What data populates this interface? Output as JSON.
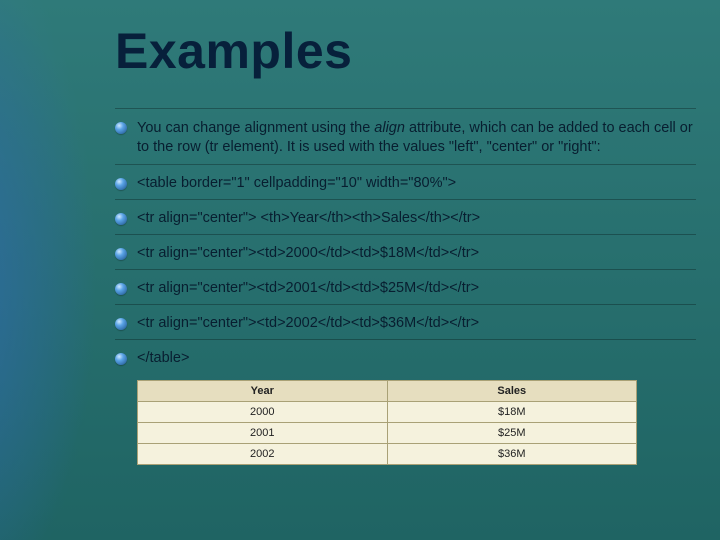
{
  "title": "Examples",
  "intro_before_italic": "You can change alignment using the ",
  "intro_italic": "align",
  "intro_after_italic": " attribute, which can be added to each cell or to the row (tr element). It is used with the values \"left\", \"center\" or \"right\":",
  "code_lines": [
    "<table border=\"1\" cellpadding=\"10\" width=\"80%\">",
    "<tr align=\"center\"> <th>Year</th><th>Sales</th></tr>",
    "<tr align=\"center\"><td>2000</td><td>$18M</td></tr>",
    "<tr align=\"center\"><td>2001</td><td>$25M</td></tr>",
    "<tr align=\"center\"><td>2002</td><td>$36M</td></tr>",
    "</table>"
  ],
  "chart_data": {
    "type": "table",
    "columns": [
      "Year",
      "Sales"
    ],
    "rows": [
      [
        "2000",
        "$18M"
      ],
      [
        "2001",
        "$25M"
      ],
      [
        "2002",
        "$36M"
      ]
    ]
  }
}
